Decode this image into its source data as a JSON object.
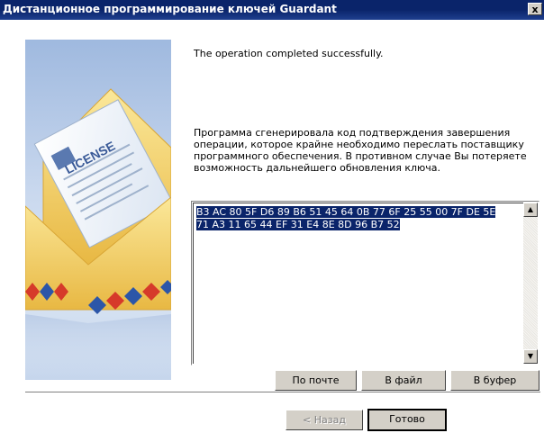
{
  "window": {
    "title": "Дистанционное программирование ключей Guardant",
    "close_label": "x"
  },
  "banner": {
    "license_text": "LICENSE"
  },
  "status": {
    "message": "The operation completed successfully."
  },
  "info": {
    "text": "Программа сгенерировала код подтверждения завершения операции, которое крайне необходимо переслать поставщику программного обеспечения. В противном случае Вы потеряете возможность дальнейшего обновления ключа."
  },
  "code": {
    "line1": "B3 AC 80 5F D6 89 B6 51 45 64 0B 77 6F 25 55 00 7F DE 5E",
    "line2": "71 A3 11 65 44 EF 31 E4 8E 8D 96 B7 52"
  },
  "scroll": {
    "up_glyph": "▲",
    "down_glyph": "▼"
  },
  "actions": {
    "by_mail": "По почте",
    "to_file": "В файл",
    "to_clipboard": "В буфер"
  },
  "nav": {
    "back": "< Назад",
    "finish": "Готово"
  },
  "colors": {
    "title_bar": "#0a246a",
    "selection": "#0a246a",
    "button_face": "#d4d0c8"
  }
}
